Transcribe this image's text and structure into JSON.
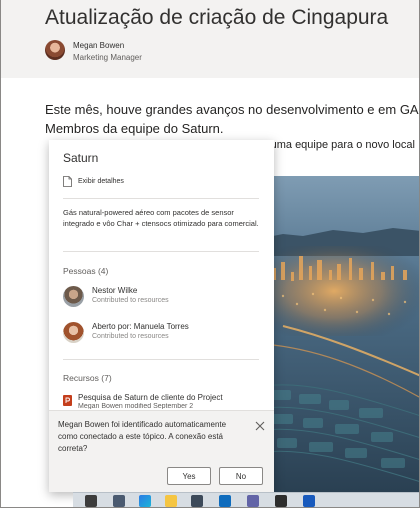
{
  "article": {
    "title": "Atualização de criação de Cingapura",
    "author_name": "Megan Bowen",
    "author_role": "Marketing Manager",
    "body_line1": "Este mês, houve grandes avanços no desenvolvimento e em GA",
    "body_line2": "Membros da equipe do Saturn.",
    "body_cont": "x: uma equipe para o novo local"
  },
  "card": {
    "title": "Saturn",
    "details_label": "Exibir detalhes",
    "description": "Gás natural-powered aéreo com pacotes de sensor integrado e vôo Char + ctensocs otimizado para comercial.",
    "people_label": "Pessoas (4)",
    "people": [
      {
        "name": "Nestor Wilke",
        "sub": "Contributed to resources"
      },
      {
        "name": "Aberto por: Manuela Torres",
        "sub": "Contributed to resources"
      }
    ],
    "resources_label": "Recursos (7)",
    "resource": {
      "title": "Pesquisa de Saturn de cliente do Project",
      "sub": "Megan Bowen modified September 2"
    }
  },
  "confirm": {
    "text": "Megan Bowen foi identificado automaticamente como conectado a este tópico. A conexão está correta?",
    "yes_label": "Yes",
    "no_label": "No"
  },
  "colors": {
    "header_bg": "#f3f2f1",
    "panel_bg": "#f3f2f1",
    "taskbar_bg": "#d7dde3"
  }
}
